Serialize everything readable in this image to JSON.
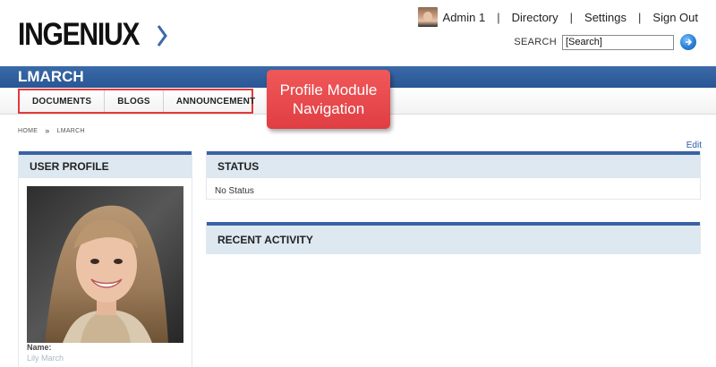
{
  "header": {
    "logo": "INGENIUX",
    "user_name": "Admin 1",
    "nav": [
      "Directory",
      "Settings",
      "Sign Out"
    ],
    "search_label": "SEARCH",
    "search_value": "[Search]"
  },
  "title_bar": {
    "title": "LMARCH"
  },
  "profile_nav": {
    "items": [
      "DOCUMENTS",
      "BLOGS",
      "ANNOUNCEMENT"
    ]
  },
  "callout": {
    "line1": "Profile Module",
    "line2": "Navigation"
  },
  "breadcrumb": {
    "home": "HOME",
    "separator": "»",
    "current": "LMARCH"
  },
  "edit_label": "Edit",
  "user_profile": {
    "heading": "USER PROFILE",
    "name_label": "Name:",
    "name_value": "Lily March"
  },
  "status": {
    "heading": "STATUS",
    "text": "No Status"
  },
  "recent_activity": {
    "heading": "RECENT ACTIVITY"
  },
  "colors": {
    "brand_blue": "#2a5694",
    "callout_red": "#e03e42",
    "panel_head_bg": "#dde8f1",
    "panel_border": "#3a62a3",
    "link_blue": "#2a5aa8"
  },
  "icons": {
    "search_go": "search-go-icon",
    "separator": "chevron-double-right"
  }
}
